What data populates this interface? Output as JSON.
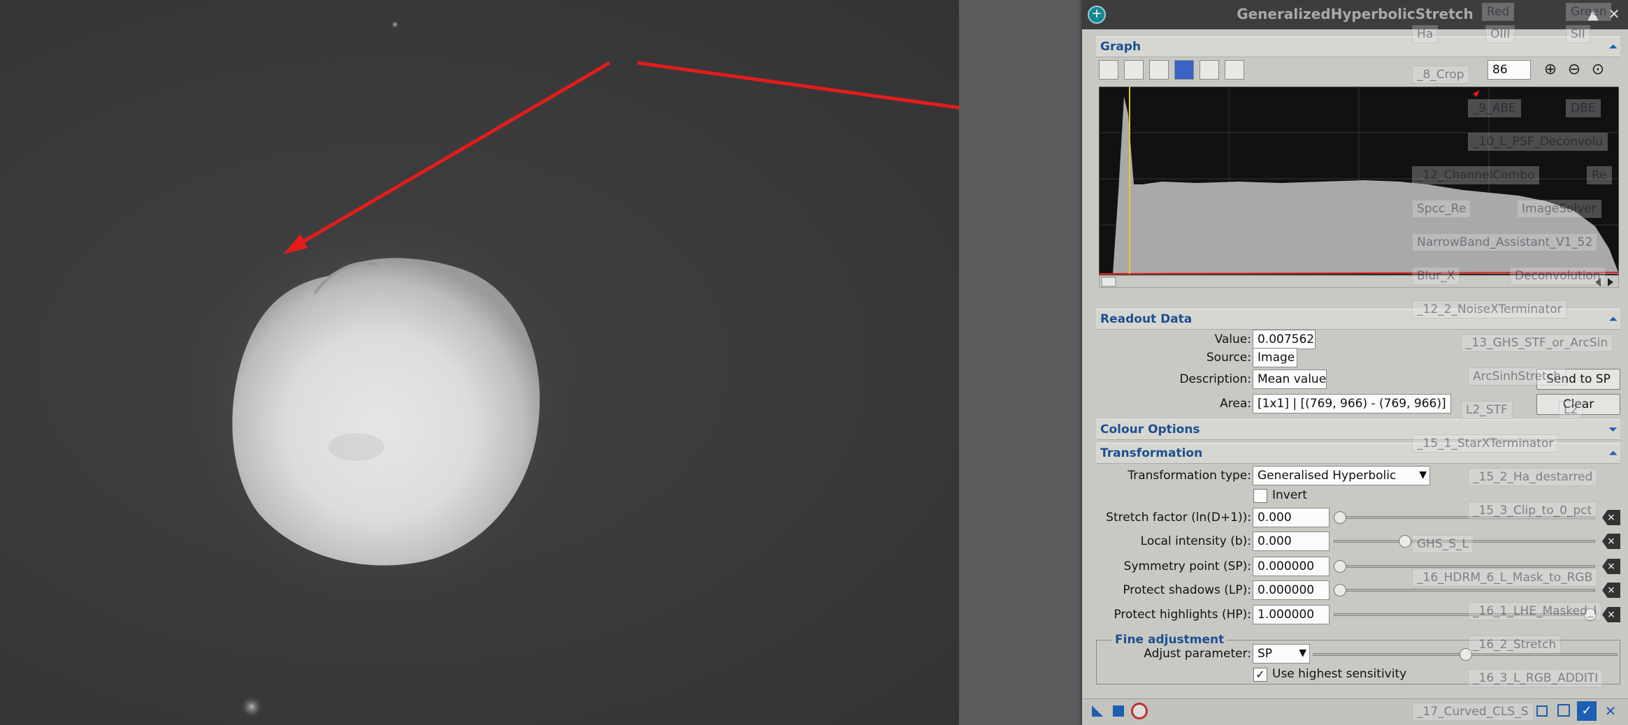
{
  "window": {
    "title": "GeneralizedHyperbolicStretch",
    "minimize_glyph": "▲",
    "close_glyph": "✕"
  },
  "graph": {
    "section_label": "Graph",
    "zoom_value": "86",
    "histogram_color": "#a9a9a9",
    "marker_color": "#f5c518",
    "curve_color": "#e02020"
  },
  "readout": {
    "section_label": "Readout Data",
    "value_label": "Value:",
    "value": "0.007562",
    "source_label": "Source:",
    "source": "Image",
    "description_label": "Description:",
    "description": "Mean value",
    "area_label": "Area:",
    "area": "[1x1] | [(769, 966) - (769, 966)]",
    "send_button": "Send to SP",
    "clear_button": "Clear"
  },
  "colour": {
    "section_label": "Colour Options"
  },
  "transformation": {
    "section_label": "Transformation",
    "type_label": "Transformation type:",
    "type_value": "Generalised Hyperbolic",
    "invert_label": "Invert",
    "invert_checked": false,
    "params": [
      {
        "label": "Stretch factor (ln(D+1)):",
        "value": "0.000",
        "level": 0.0
      },
      {
        "label": "Local intensity (b):",
        "value": "0.000",
        "level": 0.26
      },
      {
        "label": "Symmetry point (SP):",
        "value": "0.000000",
        "level": 0.0
      },
      {
        "label": "Protect shadows (LP):",
        "value": "0.000000",
        "level": 0.0
      },
      {
        "label": "Protect highlights (HP):",
        "value": "1.000000",
        "level": 1.0
      }
    ]
  },
  "fine": {
    "group_label": "Fine adjustment",
    "adjust_label": "Adjust parameter:",
    "adjust_value": "SP",
    "level": 0.5,
    "sensitivity_label": "Use highest sensitivity",
    "sensitivity_checked": true,
    "check_glyph": "✓"
  },
  "background_panel": {
    "items": [
      "Red",
      "Green",
      "Ha",
      "OIII",
      "SII",
      "_8_Crop",
      "_9_ABE",
      "DBE",
      "_10_L_PSF_Deconvolu",
      "_12_ChannelCombo",
      "Re",
      "Spcc_Re",
      "ImageSolver",
      "NarrowBand_Assistant_V1_52",
      "Blur_X",
      "Deconvolution",
      "_12_2_NoiseXTerminator",
      "_13_GHS_STF_or_ArcSin",
      "ArcSinhStretch",
      "L2_STF",
      "L2",
      "_15_1_StarXTerminator",
      "_15_2_Ha_destarred",
      "_15_3_Clip_to_0_pct",
      "GHS_S_L",
      "_16_HDRM_6_L_Mask_to_RGB",
      "_16_1_LHE_Masked_I",
      "_16_2_Stretch",
      "_16_3_L_RGB_ADDITI",
      "_17_Curved_CLS_S"
    ]
  }
}
